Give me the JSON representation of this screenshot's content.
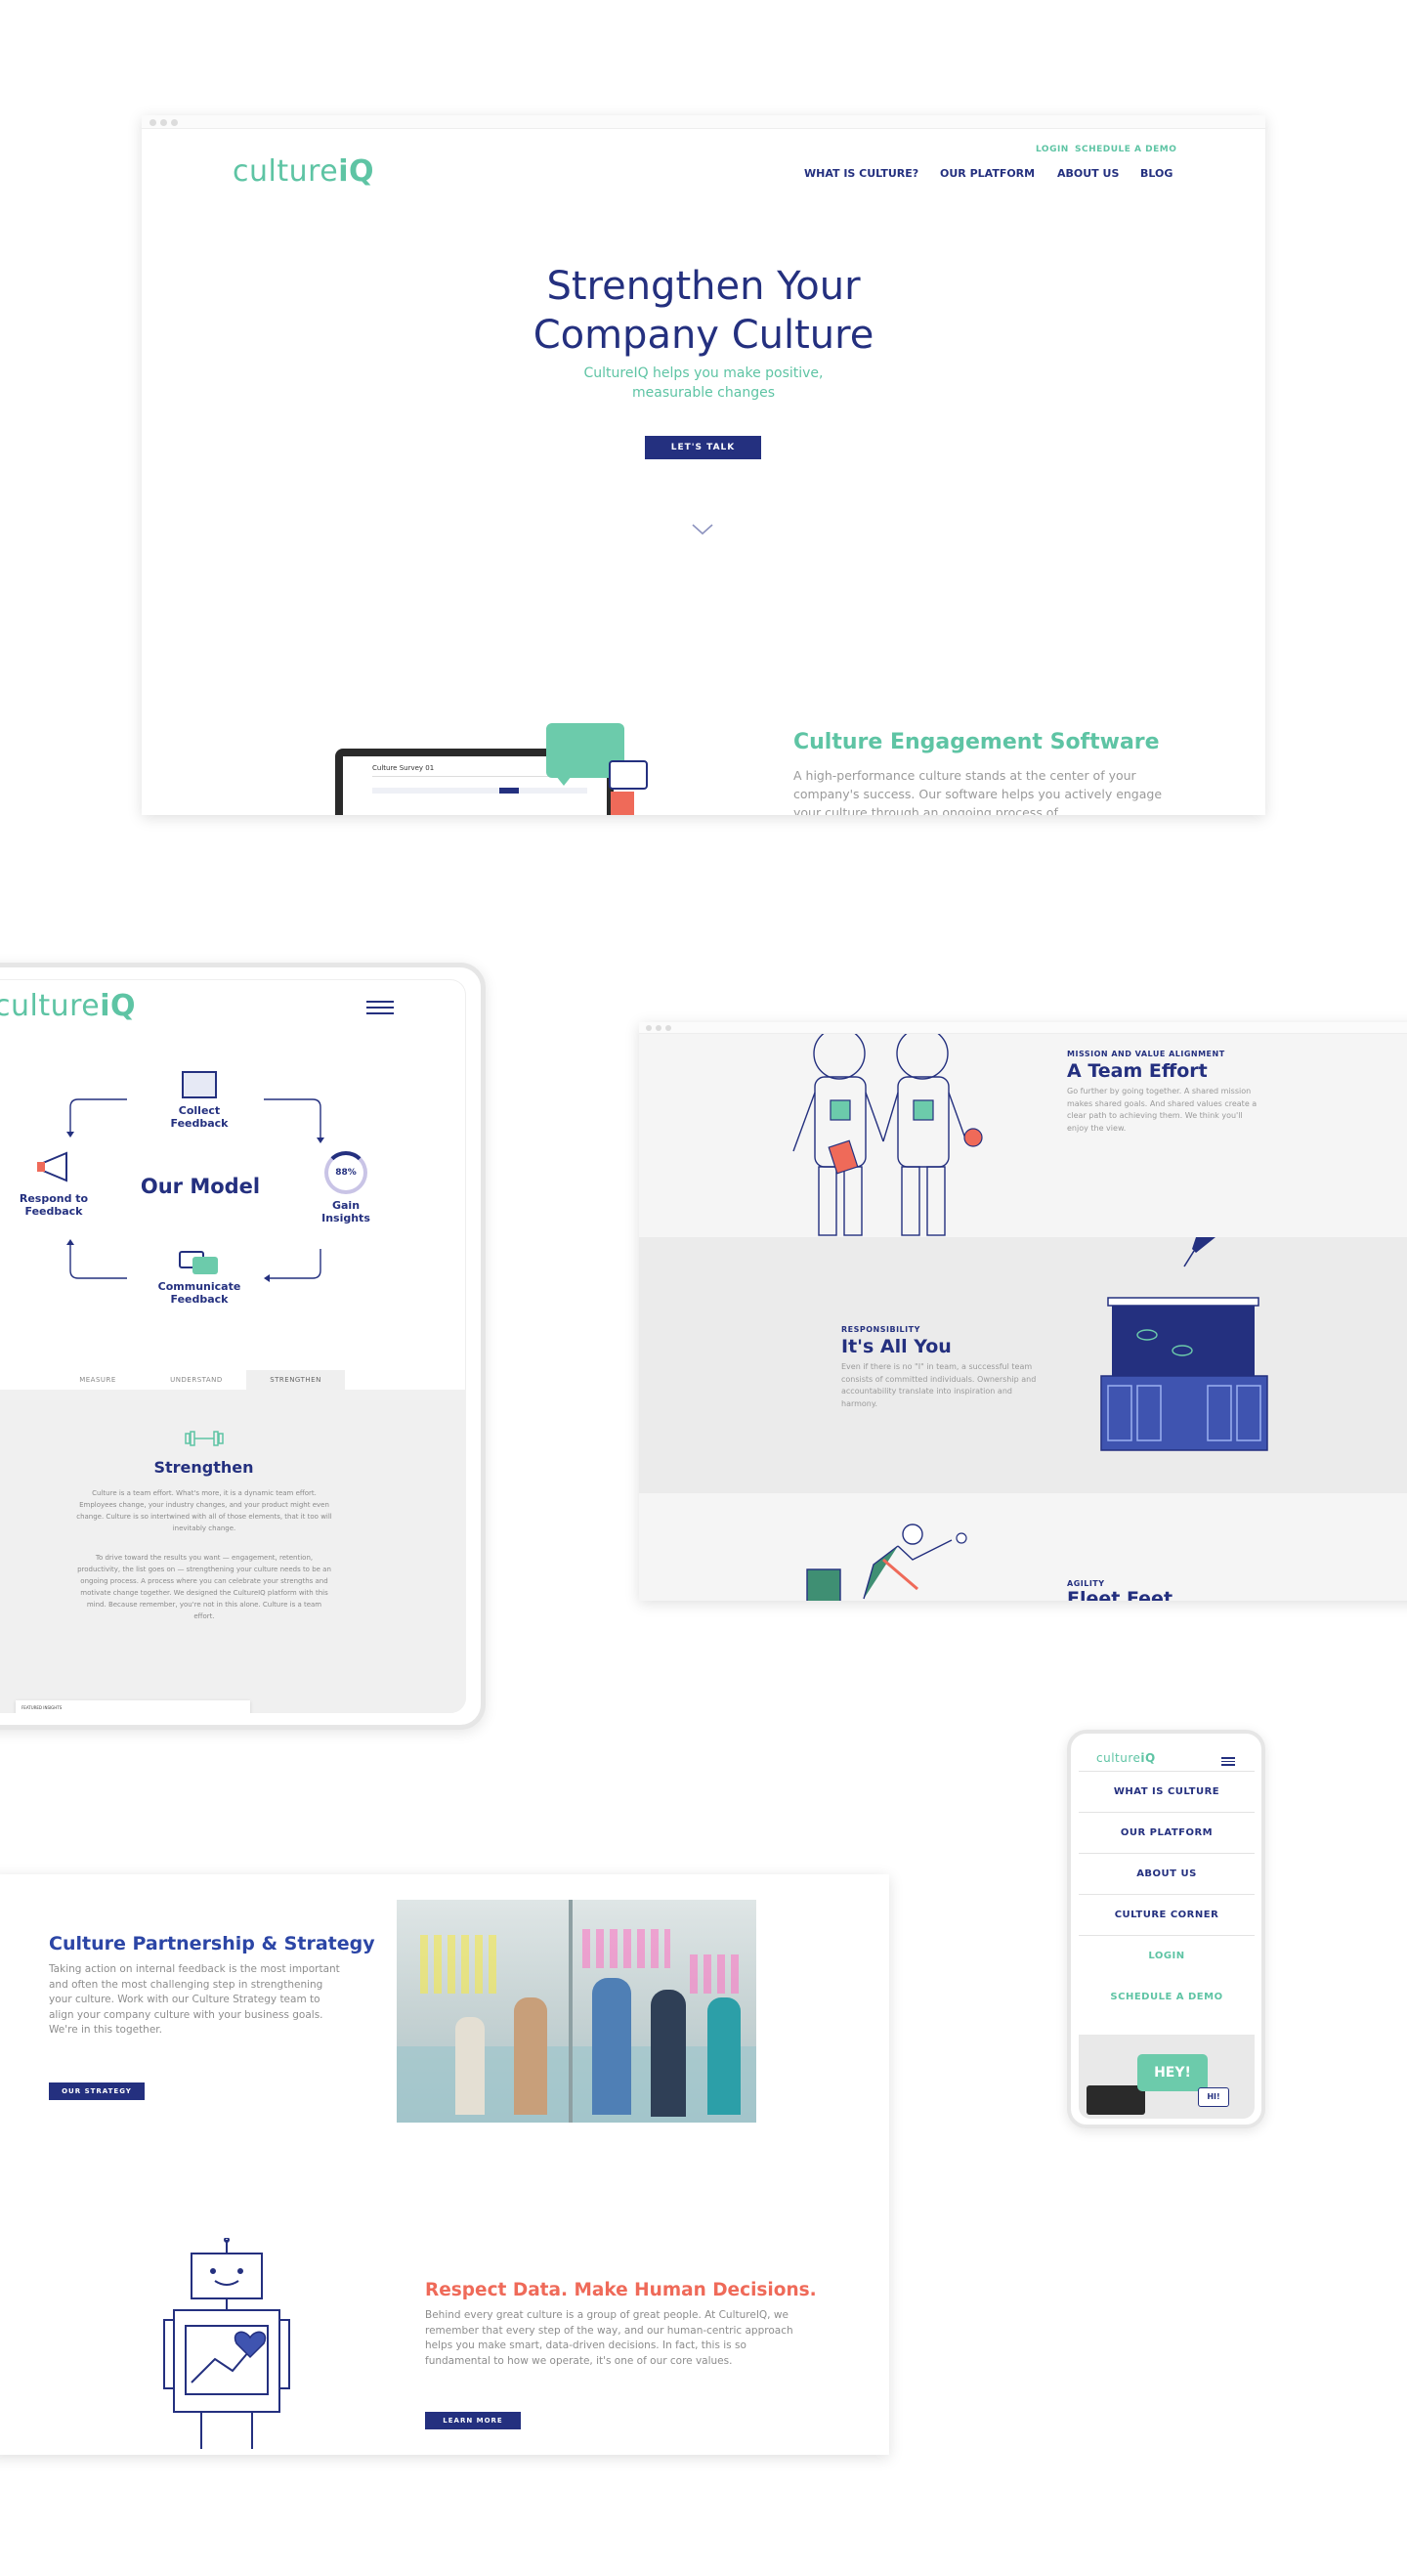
{
  "desktop": {
    "logo": {
      "prefix": "culture",
      "suffix": "iQ"
    },
    "top_links": [
      "LOGIN",
      "SCHEDULE A DEMO"
    ],
    "nav": [
      "WHAT IS CULTURE?",
      "OUR PLATFORM",
      "ABOUT US",
      "BLOG"
    ],
    "hero_title_line1": "Strengthen Your",
    "hero_title_line2": "Company Culture",
    "hero_subtitle_line1": "CultureIQ helps you make positive,",
    "hero_subtitle_line2": "measurable changes",
    "cta": "LET'S TALK",
    "section_title": "Culture Engagement Software",
    "section_text": "A high-performance culture stands at the center of your company's success. Our software helps you actively engage your culture through an ongoing process of",
    "laptop_title": "Culture Survey 01"
  },
  "tablet": {
    "logo": {
      "prefix": "culture",
      "suffix": "iQ"
    },
    "model_title": "Our Model",
    "nodes": {
      "collect": [
        "Collect",
        "Feedback"
      ],
      "gain": [
        "Gain",
        "Insights"
      ],
      "communicate": [
        "Communicate",
        "Feedback"
      ],
      "respond": [
        "Respond to",
        "Feedback"
      ]
    },
    "gauge_value": "88%",
    "tabs": [
      "MEASURE",
      "UNDERSTAND",
      "STRENGTHEN"
    ],
    "strengthen_title": "Strengthen",
    "strengthen_p1": "Culture is a team effort. What's more, it is a dynamic team effort. Employees change, your industry changes, and your product might even change. Culture is so intertwined with all of those elements, that it too will inevitably change.",
    "strengthen_p2": "To drive toward the results you want — engagement, retention, productivity, the list goes on — strengthening your culture needs to be an ongoing process. A process where you can celebrate your strengths and motivate change together. We designed the CultureIQ platform with this mind. Because remember, you're not in this alone. Culture is a team effort.",
    "bottom_card": "FEATURED INSIGHTS"
  },
  "values": {
    "items": [
      {
        "eyebrow": "MISSION AND VALUE ALIGNMENT",
        "title": "A Team Effort",
        "text": "Go further by going together. A shared mission makes shared goals. And shared values create a clear path to achieving them. We think you'll enjoy the view."
      },
      {
        "eyebrow": "RESPONSIBILITY",
        "title": "It's All You",
        "text": "Even if there is no \"I\" in team, a successful team consists of committed individuals. Ownership and accountability translate into inspiration and harmony."
      },
      {
        "eyebrow": "AGILITY",
        "title": "Fleet Feet",
        "text": ""
      }
    ]
  },
  "mobile": {
    "logo": {
      "prefix": "culture",
      "suffix": "iQ"
    },
    "menu": [
      "WHAT IS CULTURE",
      "OUR PLATFORM",
      "ABOUT US",
      "CULTURE CORNER",
      "LOGIN",
      "SCHEDULE A DEMO"
    ],
    "bubble_big": "HEY!",
    "bubble_small": "HI!"
  },
  "partnership": {
    "title": "Culture Partnership & Strategy",
    "text": "Taking action on internal feedback is the most important and often the most challenging step in strengthening your culture. Work with our Culture Strategy team to align your company culture with your business goals. We're in this together.",
    "cta": "OUR STRATEGY",
    "data_title": "Respect Data. Make Human Decisions.",
    "data_text": "Behind every great culture is a group of great people. At CultureIQ, we remember that every step of the way, and our human-centric approach helps you make smart, data-driven decisions. In fact, this is so fundamental to how we operate, it's one of our core values.",
    "data_cta": "LEARN MORE"
  },
  "colors": {
    "navy": "#24307f",
    "mint": "#5ec4a4",
    "coral": "#ef6a59",
    "light_gray": "#f1f1f1"
  }
}
